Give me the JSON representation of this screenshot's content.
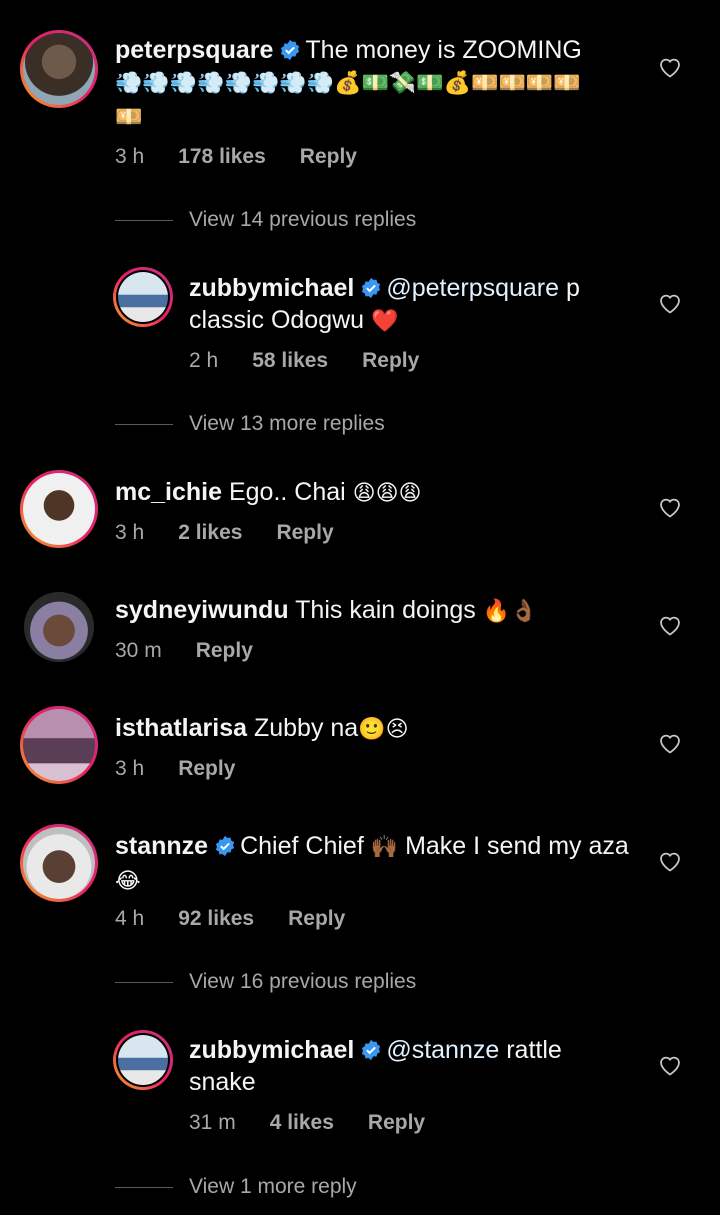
{
  "colors": {
    "background": "#000000",
    "text": "#f5f5f5",
    "secondary": "#a8a8a8",
    "verified": "#3897f0",
    "story_ring": "#e91e63"
  },
  "comments": [
    {
      "username": "peterpsquare",
      "verified": true,
      "text": "The money is ZOOMING",
      "emojis_line": "💨💨💨💨💨💨💨💨💰💵💸💵💰💴💴💴💴",
      "emojis_line2": "💴",
      "time": "3 h",
      "likes": "178 likes",
      "reply": "Reply",
      "view_replies": "View 14 previous replies"
    },
    {
      "username": "zubbymichael",
      "verified": true,
      "mention": "@peterpsquare",
      "text": "p classic Odogwu",
      "emoji": "❤️",
      "time": "2 h",
      "likes": "58 likes",
      "reply": "Reply",
      "view_replies": "View 13 more replies"
    },
    {
      "username": "mc_ichie",
      "verified": false,
      "text": "Ego.. Chai",
      "emoji": "😩😩😩",
      "time": "3 h",
      "likes": "2 likes",
      "reply": "Reply"
    },
    {
      "username": "sydneyiwundu",
      "verified": false,
      "text": "This kain doings",
      "emoji": "🔥👌🏾",
      "time": "30 m",
      "reply": "Reply"
    },
    {
      "username": "isthatlarisa",
      "verified": false,
      "text": "Zubby na",
      "emoji": "🙂😣",
      "time": "3 h",
      "reply": "Reply"
    },
    {
      "username": "stannze",
      "verified": true,
      "text_a": "Chief Chief",
      "emoji_a": "🙌🏾",
      "text_b": "Make I send my aza",
      "emoji_b": "😂",
      "time": "4 h",
      "likes": "92 likes",
      "reply": "Reply",
      "view_replies": "View 16 previous replies"
    },
    {
      "username": "zubbymichael",
      "verified": true,
      "mention": "@stannze",
      "text": "rattle snake",
      "time": "31 m",
      "likes": "4 likes",
      "reply": "Reply",
      "view_replies": "View 1 more reply"
    }
  ],
  "icons": {
    "like": "heart-outline-icon",
    "verified": "verified-badge-icon"
  }
}
